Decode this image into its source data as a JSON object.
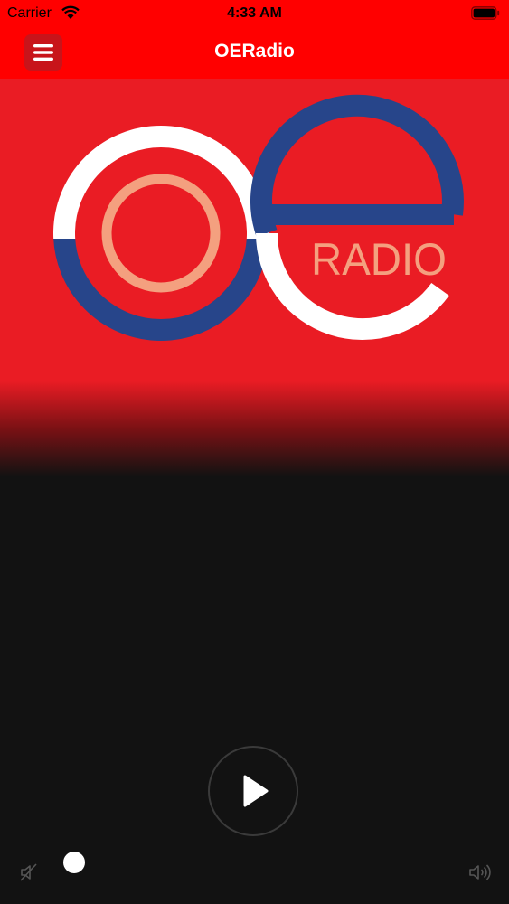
{
  "status_bar": {
    "carrier": "Carrier",
    "time": "4:33 AM"
  },
  "nav": {
    "title": "OERadio",
    "menu_icon": "hamburger-menu-icon"
  },
  "logo": {
    "wordmark": "RADIO"
  },
  "player": {
    "play_icon": "play-icon",
    "volume_level": 0.03,
    "mute_icon": "speaker-muted-icon",
    "volume_icon": "speaker-volume-icon"
  },
  "colors": {
    "brand_red": "#ff0000",
    "artwork_red": "#ea1c24",
    "logo_blue": "#27458a",
    "logo_salmon": "#f4a07f",
    "background": "#121212"
  }
}
